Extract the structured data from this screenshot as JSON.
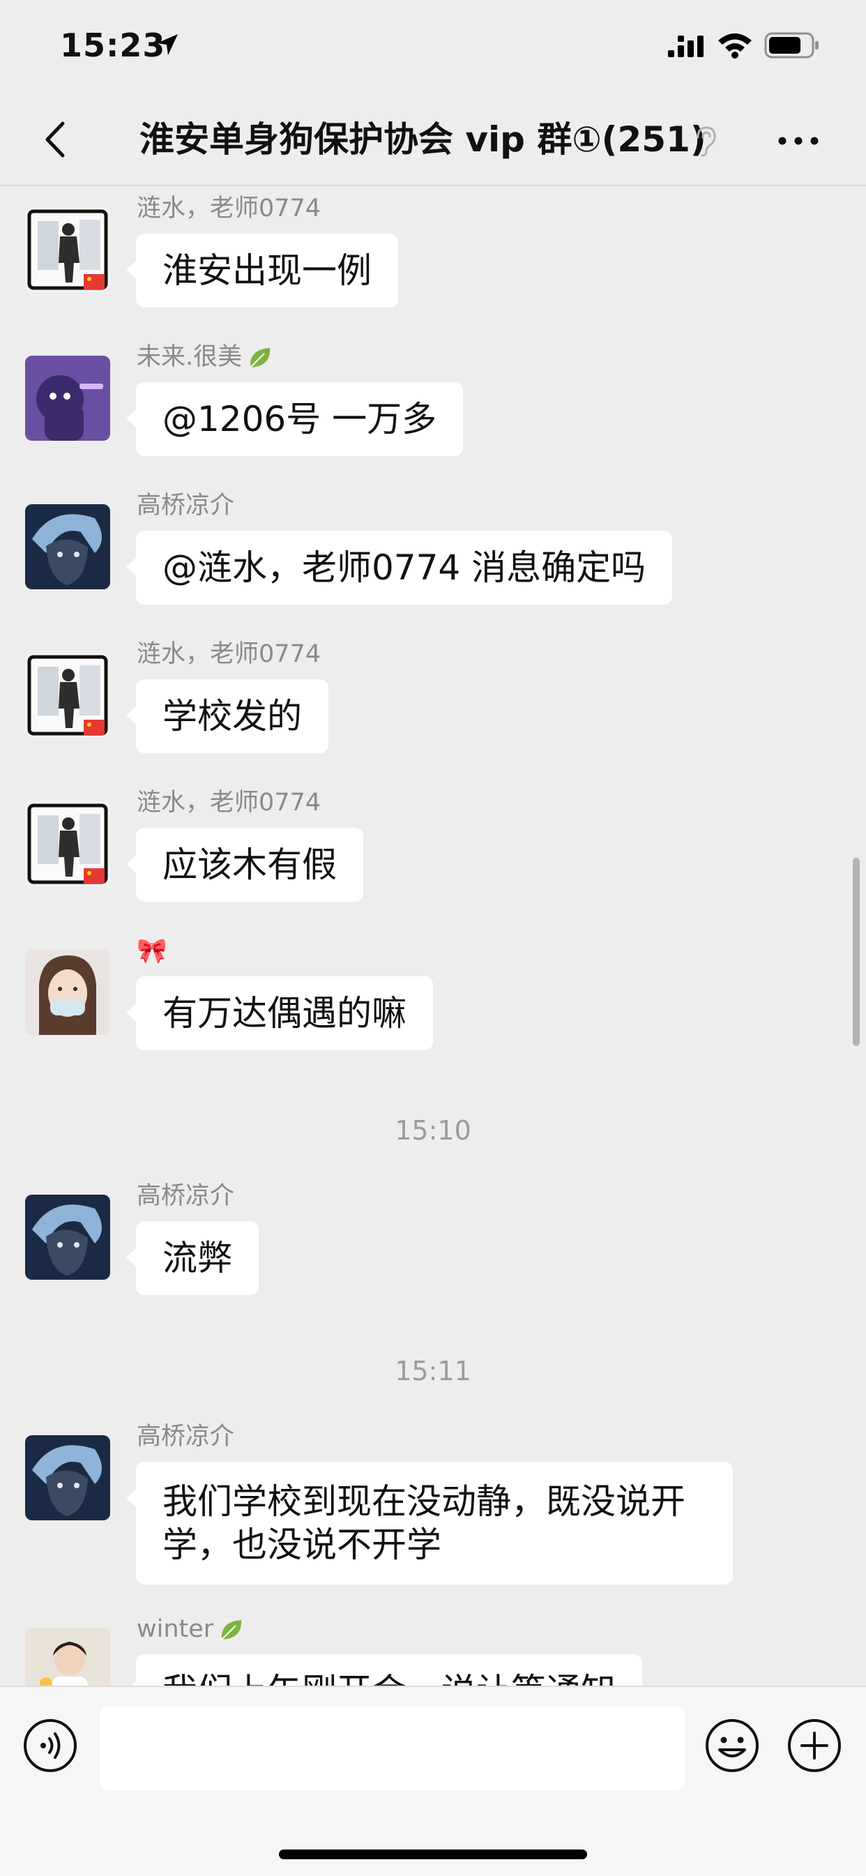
{
  "status_bar": {
    "time": "15:23"
  },
  "nav": {
    "title": "淮安单身狗保护协会 vip 群①(251)"
  },
  "messages": [
    {
      "sender": "涟水，老师0774",
      "text": "淮安出现一例",
      "avatar": "phone-selfie-avatar"
    },
    {
      "sender": "未来.很美",
      "text": "@1206号 一万多",
      "avatar": "purple-cartoon-avatar"
    },
    {
      "sender": "高桥凉介",
      "text": "@涟水，老师0774 消息确定吗",
      "avatar": "anime-blue-hair-avatar"
    },
    {
      "sender": "涟水，老师0774",
      "text": "学校发的",
      "avatar": "phone-selfie-avatar"
    },
    {
      "sender": "涟水，老师0774",
      "text": "应该木有假",
      "avatar": "phone-selfie-avatar"
    },
    {
      "sender": "🎀",
      "text": "有万达偶遇的嘛",
      "avatar": "girl-photo-avatar"
    },
    {
      "sender": "高桥凉介",
      "text": "流弊",
      "avatar": "anime-blue-hair-avatar"
    },
    {
      "sender": "高桥凉介",
      "text": "我们学校到现在没动静，既没说开学，也没说不开学",
      "avatar": "anime-blue-hair-avatar"
    },
    {
      "sender": "winter",
      "text": "我们上午刚开会，说让等通知",
      "avatar": "child-photo-avatar"
    }
  ],
  "timestamps": [
    "15:10",
    "15:11"
  ],
  "input": {
    "placeholder": ""
  },
  "colors": {
    "background": "#ededed",
    "bubble": "#ffffff",
    "leaf": "#7cb342"
  }
}
